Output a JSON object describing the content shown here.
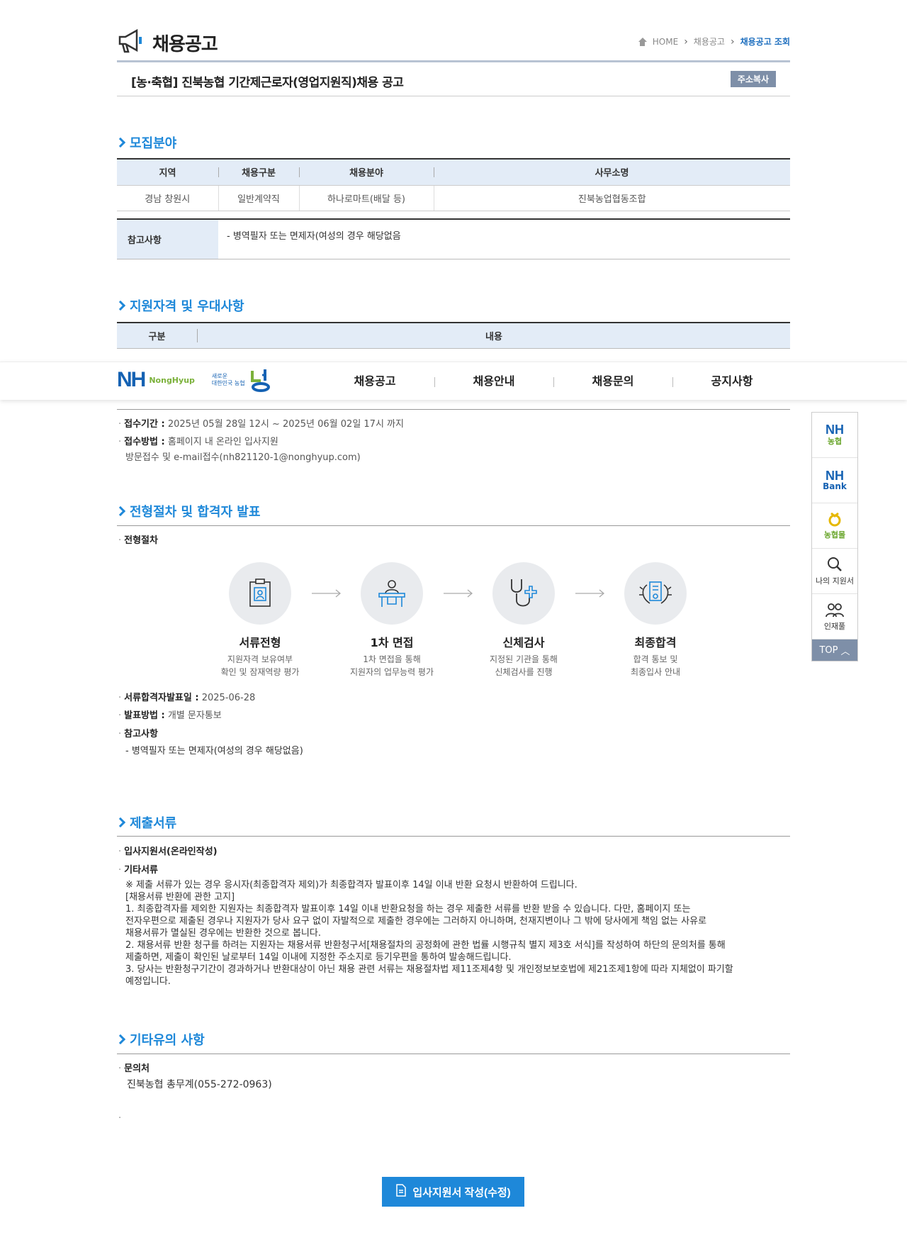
{
  "header": {
    "title": "채용공고",
    "breadcrumb": [
      "HOME",
      "채용공고",
      "채용공고 조회"
    ]
  },
  "notice": {
    "title": "[농·축협] 진북농협 기간제근로자(영업지원직)채용 공고",
    "copy_label": "주소복사"
  },
  "recruit": {
    "heading": "모집분야",
    "columns": [
      "지역",
      "채용구분",
      "채용분야",
      "사무소명"
    ],
    "row": [
      "경남 창원시",
      "일반계약직",
      "하나로마트(배달 등)",
      "진북농업협동조합"
    ],
    "ref_label": "참고사항",
    "ref_text": "- 병역필자 또는 면제자(여성의 경우 해당없음"
  },
  "qualification": {
    "heading": "지원자격 및 우대사항",
    "columns": [
      "구분",
      "내용"
    ]
  },
  "gnb": {
    "logo_nh": "NH",
    "logo_text": "NongHyup",
    "logo_sub1": "새로운",
    "logo_sub2": "대한민국 농협",
    "menu": [
      "채용공고",
      "채용안내",
      "채용문의",
      "공지사항"
    ]
  },
  "quick": {
    "nh1": "NH",
    "nh1_sub": "농협",
    "nh2": "NH",
    "nh2_sub": "Bank",
    "mall": "농협몰",
    "my": "나의 지원서",
    "pool": "인재풀",
    "top": "TOP"
  },
  "reception": {
    "period_label": "접수기간 :",
    "period": "2025년 05월 28일 12시 ~ 2025년 06월 02일 17시 까지",
    "method_label": "접수방법 :",
    "method": "홈페이지 내 온라인 입사지원",
    "method2": "방문접수 및 e-mail접수(nh821120-1@nonghyup.com)"
  },
  "process": {
    "heading": "전형절차 및 합격자 발표",
    "label": "전형절차",
    "steps": [
      {
        "name": "서류전형",
        "d1": "지원자격 보유여부",
        "d2": "확인 및 잠재역량 평가"
      },
      {
        "name": "1차 면접",
        "d1": "1차 면접을 통해",
        "d2": "지원자의 업무능력 평가"
      },
      {
        "name": "신체검사",
        "d1": "지정된 기관을 통해",
        "d2": "신체검사를 진행"
      },
      {
        "name": "최종합격",
        "d1": "합격 통보 및",
        "d2": "최종입사 안내"
      }
    ],
    "pass_date_label": "서류합격자발표일 :",
    "pass_date": "2025-06-28",
    "announce_label": "발표방법 :",
    "announce": "개별 문자통보",
    "ref_label": "참고사항",
    "ref_text": "- 병역필자 또는 면제자(여성의 경우 해당없음)"
  },
  "documents": {
    "heading": "제출서류",
    "item1": "입사지원서(온라인작성)",
    "item2": "기타서류",
    "notes": "※ 제출 서류가 있는 경우 응시자(최종합격자 제외)가 최종합격자 발표이후 14일 이내 반환 요청시 반환하여 드립니다.\n[채용서류 반환에 관한 고지]\n 1. 최종합격자를 제외한 지원자는 최종합격자 발표이후 14일 이내 반환요청을 하는 경우 제출한 서류를 반환 받을 수 있습니다. 다만, 홈페이지 또는\n전자우편으로 제출된 경우나 지원자가 당사 요구 없이 자발적으로 제출한 경우에는 그러하지 아니하며, 천재지변이나 그 밖에 당사에게 책임 없는 사유로\n채용서류가 멸실된 경우에는 반환한 것으로 봅니다.\n 2. 채용서류 반환 청구를 하려는 지원자는 채용서류 반환청구서[채용절차의 공정화에 관한 법률 시행규칙 별지 제3호 서식]를 작성하여 하단의 문의처를 통해\n제출하면, 제출이 확인된 날로부터 14일 이내에 지정한 주소지로 등기우편을 통하여 발송해드립니다.\n 3. 당사는 반환청구기간이 경과하거나 반환대상이 아닌 채용 관련 서류는 채용절차법 제11조제4항 및 개인정보보호법에 제21조제1항에 따라 지체없이 파기할\n예정입니다."
  },
  "etc": {
    "heading": "기타유의 사항",
    "contact_label": "문의처",
    "contact": "진북농협 총무계(055-272-0963)"
  },
  "apply_label": "입사지원서 작성(수정)",
  "colors": {
    "accent": "#1e88d9",
    "header_bg": "#e3ecf7",
    "btn_gray": "#7e8fa8"
  }
}
